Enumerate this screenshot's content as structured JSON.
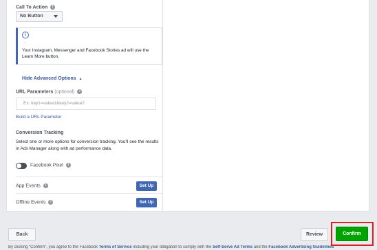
{
  "call_to_action": {
    "label": "Call To Action",
    "value": "No Button"
  },
  "notice": {
    "icon": "info-circle-icon",
    "ellipsis": "...",
    "text": "Your Instagram, Messenger and Facebook Stories ad will use the Learn More button."
  },
  "advanced": {
    "hide_label": "Hide Advanced Options",
    "arrow": "▲"
  },
  "url_parameters": {
    "label": "URL Parameters",
    "optional": "(optional)",
    "placeholder": "Ex: key1=value1&key2=value2",
    "build_link": "Build a URL Parameter"
  },
  "conversion_tracking": {
    "heading": "Conversion Tracking",
    "description": "Select one or more options for conversion tracking. You'll see the results in Ads Manager along with ad performance data.",
    "pixel_label": "Facebook Pixel",
    "pixel_enabled": false
  },
  "events": [
    {
      "label": "App Events",
      "button": "Set Up"
    },
    {
      "label": "Offline Events",
      "button": "Set Up"
    }
  ],
  "footer": {
    "back": "Back",
    "review": "Review",
    "confirm": "Confirm",
    "legal_prefix": "By clicking \"Confirm\", you agree to the Facebook",
    "legal_link1": "Terms of Service",
    "legal_mid": "including your obligation to comply with the",
    "legal_link2": "Self-Serve Ad Terms",
    "legal_mid2": "and the",
    "legal_link3": "Facebook Advertising Guidelines"
  },
  "colors": {
    "accent": "#4267b2",
    "confirm": "#00a400",
    "highlight": "#e01f1f",
    "background": "#e9ebee"
  }
}
